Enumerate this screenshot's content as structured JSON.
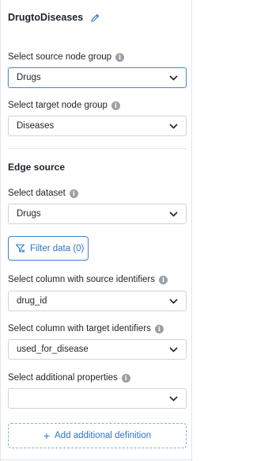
{
  "header": {
    "title": "DrugtoDiseases",
    "edit_icon": "pencil-icon"
  },
  "source_node_group": {
    "label": "Select source node group",
    "value": "Drugs"
  },
  "target_node_group": {
    "label": "Select target node group",
    "value": "Diseases"
  },
  "edge_source": {
    "title": "Edge source",
    "dataset": {
      "label": "Select dataset",
      "value": "Drugs"
    },
    "filter_button": "Filter data (0)",
    "source_column": {
      "label": "Select column with source identifiers",
      "value": "drug_id"
    },
    "target_column": {
      "label": "Select column with target identifiers",
      "value": "used_for_disease"
    },
    "additional_properties": {
      "label": "Select additional properties",
      "value": ""
    },
    "add_definition": "Add additional definition"
  },
  "colors": {
    "accent": "#2f74c9",
    "focus_border": "#4a90e2",
    "border": "#d0d4d9",
    "info_icon": "#9aa0a6"
  }
}
